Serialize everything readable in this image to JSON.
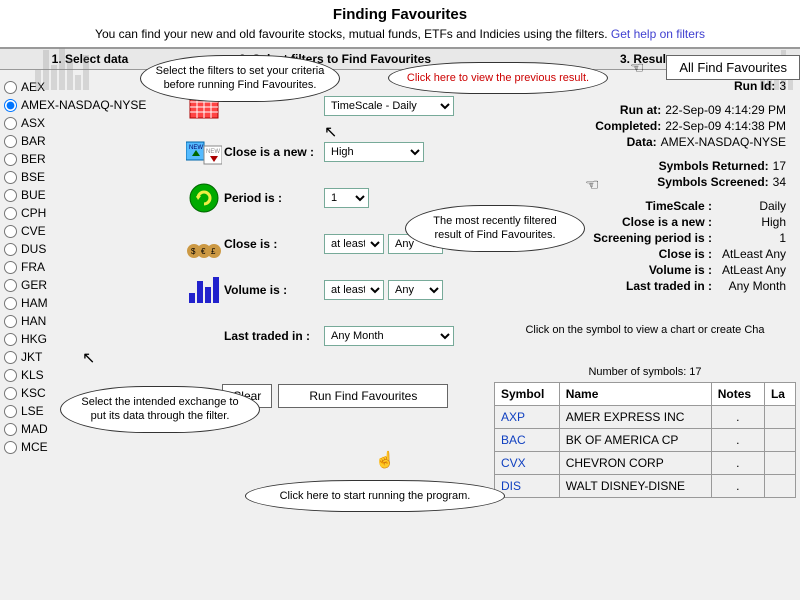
{
  "header": {
    "title": "Finding Favourites",
    "subtitle_pre": "You can find your new and old favourite stocks, mutual funds, ETFs and Indicies using the filters. ",
    "help_link": "Get help on filters",
    "top_button": "All Find Favourites"
  },
  "columns": {
    "c1": "1. Select data",
    "c2": "2. Select filters to Find Favourites",
    "c3": "3. Result"
  },
  "exchanges": [
    "AEX",
    "AMEX-NASDAQ-NYSE",
    "ASX",
    "BAR",
    "BER",
    "BSE",
    "BUE",
    "CPH",
    "CVE",
    "DUS",
    "FRA",
    "GER",
    "HAM",
    "HAN",
    "HKG",
    "JKT",
    "KLS",
    "KSC",
    "LSE",
    "MAD",
    "MCE"
  ],
  "selected_exchange_index": 1,
  "filters": {
    "timescale": {
      "value": "TimeScale - Daily"
    },
    "close_new": {
      "label": "Close is a new :",
      "value": "High"
    },
    "period": {
      "label": "Period is :",
      "value": "1"
    },
    "close_is": {
      "label": "Close is :",
      "cmp": "at least",
      "val": "Any"
    },
    "volume_is": {
      "label": "Volume is :",
      "cmp": "at least",
      "val": "Any"
    },
    "last_traded": {
      "label": "Last traded in :",
      "value": "Any Month"
    }
  },
  "buttons": {
    "clear": "Clear",
    "run": "Run Find Favourites"
  },
  "result": {
    "run_id_label": "Run Id:",
    "run_id": "3",
    "run_at_label": "Run at:",
    "run_at": "22-Sep-09 4:14:29 PM",
    "completed_label": "Completed:",
    "completed": "22-Sep-09 4:14:38 PM",
    "data_label": "Data:",
    "data": "AMEX-NASDAQ-NYSE",
    "returned_label": "Symbols Returned:",
    "returned": "17",
    "screened_label": "Symbols Screened:",
    "screened": "34",
    "ts_label": "TimeScale :",
    "ts": "Daily",
    "cn_label": "Close is a new :",
    "cn": "High",
    "sp_label": "Screening period is :",
    "sp": "1",
    "ci_label": "Close is :",
    "ci": "AtLeast Any",
    "vi_label": "Volume is :",
    "vi": "AtLeast Any",
    "lt_label": "Last traded in :",
    "lt": "Any Month"
  },
  "table": {
    "instruction": "Click on the symbol to view a chart or create Cha",
    "count_label": "Number of symbols: 17",
    "headers": {
      "symbol": "Symbol",
      "name": "Name",
      "notes": "Notes",
      "last": "La"
    },
    "rows": [
      {
        "sym": "AXP",
        "name": "AMER EXPRESS INC",
        "notes": "."
      },
      {
        "sym": "BAC",
        "name": "BK OF AMERICA CP",
        "notes": "."
      },
      {
        "sym": "CVX",
        "name": "CHEVRON CORP",
        "notes": "."
      },
      {
        "sym": "DIS",
        "name": "WALT DISNEY-DISNE",
        "notes": "."
      }
    ]
  },
  "callouts": {
    "c1": "Select the filters to set your criteria before running Find Favourites.",
    "c2": "Click here to view the previous result.",
    "c3": "The most recently filtered result of Find Favourites.",
    "c4": "Select the intended exchange to put its data through the filter.",
    "c5": "Click here to start running the program."
  }
}
